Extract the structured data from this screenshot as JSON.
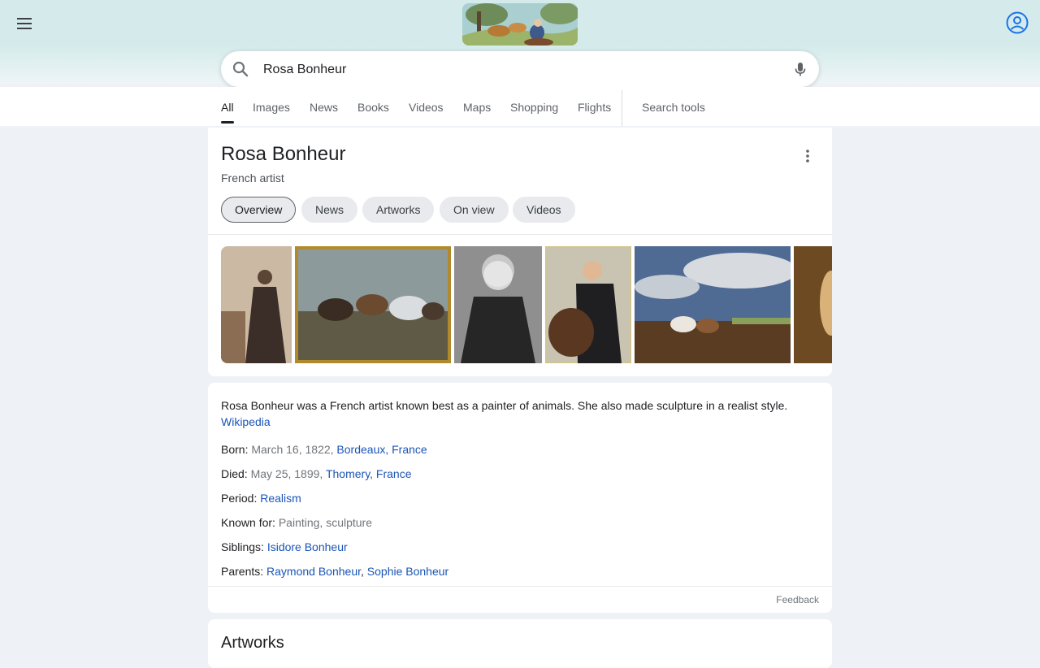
{
  "header": {
    "doodle_alt": "Rosa Bonheur doodle"
  },
  "search": {
    "query": "Rosa Bonheur"
  },
  "tabs": [
    {
      "label": "All"
    },
    {
      "label": "Images"
    },
    {
      "label": "News"
    },
    {
      "label": "Books"
    },
    {
      "label": "Videos"
    },
    {
      "label": "Maps"
    },
    {
      "label": "Shopping"
    },
    {
      "label": "Flights"
    },
    {
      "label": "Search tools"
    }
  ],
  "knowledge_panel": {
    "title": "Rosa Bonheur",
    "subtitle": "French artist",
    "chips": [
      {
        "label": "Overview"
      },
      {
        "label": "News"
      },
      {
        "label": "Artworks"
      },
      {
        "label": "On view"
      },
      {
        "label": "Videos"
      }
    ],
    "description": "Rosa Bonheur was a French artist known best as a painter of animals. She also made sculpture in a realist style.",
    "source_link": "Wikipedia",
    "facts": {
      "born": {
        "label": "Born:",
        "value": "March 16, 1822, ",
        "link": "Bordeaux, France"
      },
      "died": {
        "label": "Died:",
        "value": "May 25, 1899, ",
        "link": "Thomery, France"
      },
      "period": {
        "label": "Period:",
        "link": "Realism"
      },
      "known_for": {
        "label": "Known for:",
        "value": "Painting, sculpture"
      },
      "siblings": {
        "label": "Siblings:",
        "link": "Isidore Bonheur"
      },
      "parents": {
        "label": "Parents:",
        "link1": "Raymond Bonheur",
        "sep": ", ",
        "link2": "Sophie Bonheur"
      }
    },
    "feedback": "Feedback"
  },
  "artworks": {
    "title": "Artworks"
  },
  "colors": {
    "header_bg": "#d5ebeb",
    "link": "#1a55b6",
    "muted": "#70757a"
  }
}
